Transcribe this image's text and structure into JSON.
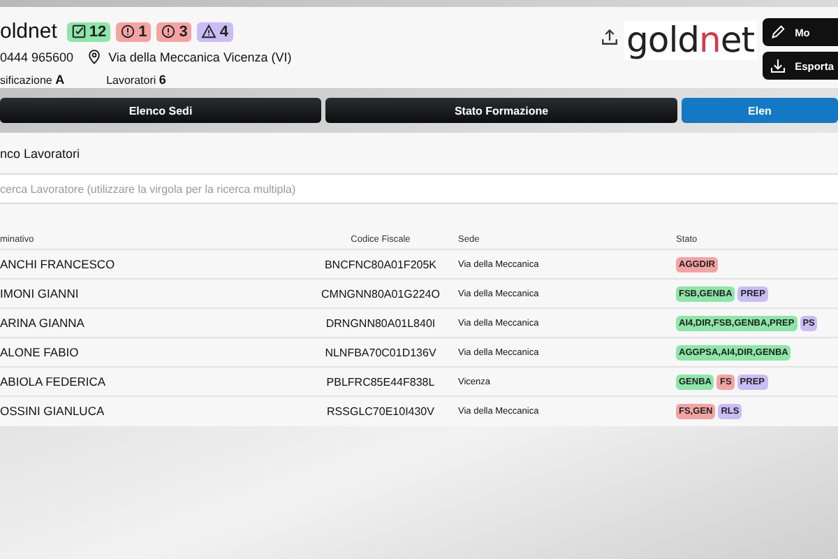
{
  "header": {
    "company": "oldnet",
    "counters": [
      {
        "kind": "check",
        "value": "12",
        "color": "#8ee6a8"
      },
      {
        "kind": "alert",
        "value": "1",
        "color": "#f4a3a3"
      },
      {
        "kind": "alert",
        "value": "3",
        "color": "#f4a3a3"
      },
      {
        "kind": "warning",
        "value": "4",
        "color": "#c9bdf5"
      }
    ],
    "phone": "0444 965600",
    "address": "Via della Meccanica Vicenza (VI)",
    "facts": [
      {
        "label": "sificazione",
        "value": "A"
      },
      {
        "label": "Lavoratori",
        "value": "6"
      }
    ],
    "logo": {
      "start": "gold",
      "accent": "n",
      "end": "et"
    },
    "buttons": [
      {
        "kind": "edit",
        "label": "Mo"
      },
      {
        "kind": "download",
        "label": "Esporta"
      }
    ]
  },
  "tabs": [
    {
      "label": "Elenco Sedi",
      "selected": false
    },
    {
      "label": "Stato Formazione",
      "selected": false
    },
    {
      "label": "Elen",
      "selected": true
    }
  ],
  "panel": {
    "title": "nco Lavoratori",
    "search": {
      "placeholder": "cerca Lavoratore (utilizzare la virgola per la ricerca multipla)"
    }
  },
  "table": {
    "columns": [
      "minativo",
      "Codice Fiscale",
      "Sede",
      "Stato"
    ],
    "rows": [
      {
        "name": "ANCHI FRANCESCO",
        "code": "BNCFNC80A01F205K",
        "site": "Via della Meccanica",
        "tags": [
          {
            "text": "AGGDIR",
            "color": "#f4a3a3"
          }
        ]
      },
      {
        "name": "IMONI GIANNI",
        "code": "CMNGNN80A01G224O",
        "site": "Via della Meccanica",
        "tags": [
          {
            "text": "FSB,GENBA",
            "color": "#8ee6a8"
          },
          {
            "text": "PREP",
            "color": "#c9bdf5"
          }
        ]
      },
      {
        "name": "ARINA GIANNA",
        "code": "DRNGNN80A01L840I",
        "site": "Via della Meccanica",
        "tags": [
          {
            "text": "AI4,DIR,FSB,GENBA,PREP",
            "color": "#8ee6a8"
          },
          {
            "text": "PS",
            "color": "#c9bdf5"
          }
        ]
      },
      {
        "name": "ALONE FABIO",
        "code": "NLNFBA70C01D136V",
        "site": "Via della Meccanica",
        "tags": [
          {
            "text": "AGGPSA,AI4,DIR,GENBA",
            "color": "#8ee6a8"
          }
        ]
      },
      {
        "name": "ABIOLA FEDERICA",
        "code": "PBLFRC85E44F838L",
        "site": "Vicenza",
        "tags": [
          {
            "text": "GENBA",
            "color": "#8ee6a8"
          },
          {
            "text": "FS",
            "color": "#f4a3a3"
          },
          {
            "text": "PREP",
            "color": "#c9bdf5"
          }
        ]
      },
      {
        "name": "OSSINI GIANLUCA",
        "code": "RSSGLC70E10I430V",
        "site": "Via della Meccanica",
        "tags": [
          {
            "text": "FS,GEN",
            "color": "#f4a3a3"
          },
          {
            "text": "RLS",
            "color": "#c9bdf5"
          }
        ]
      }
    ]
  }
}
